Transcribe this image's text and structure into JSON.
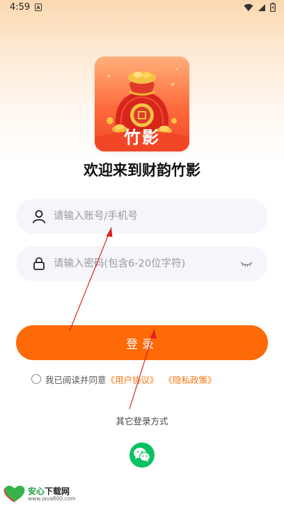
{
  "status_bar": {
    "time": "4:59",
    "notification_icon": "A",
    "icons": [
      "wifi-icon",
      "signal-icon",
      "battery-icon"
    ]
  },
  "app": {
    "logo_text": "竹影",
    "welcome": "欢迎来到财韵竹影"
  },
  "form": {
    "account_placeholder": "请输入账号/手机号",
    "password_placeholder": "请输入密码(包含6-20位字符)",
    "login_label": "登录"
  },
  "agreement": {
    "prefix": "我已阅读并同意",
    "user_agreement": "《用户协议》",
    "privacy_policy": "《隐私政策》"
  },
  "other_login": {
    "label": "其它登录方式",
    "methods": [
      "wechat-icon"
    ]
  },
  "watermark": {
    "title_green": "安心",
    "title_dark": "下载网",
    "url": "www.java800.com",
    "heart_text": "安心\n下载"
  },
  "colors": {
    "accent": "#fd6a07",
    "link": "#f7760e",
    "field_bg": "#f4f6fb",
    "wechat": "#08c160",
    "annotation_arrow": "#e02020"
  }
}
